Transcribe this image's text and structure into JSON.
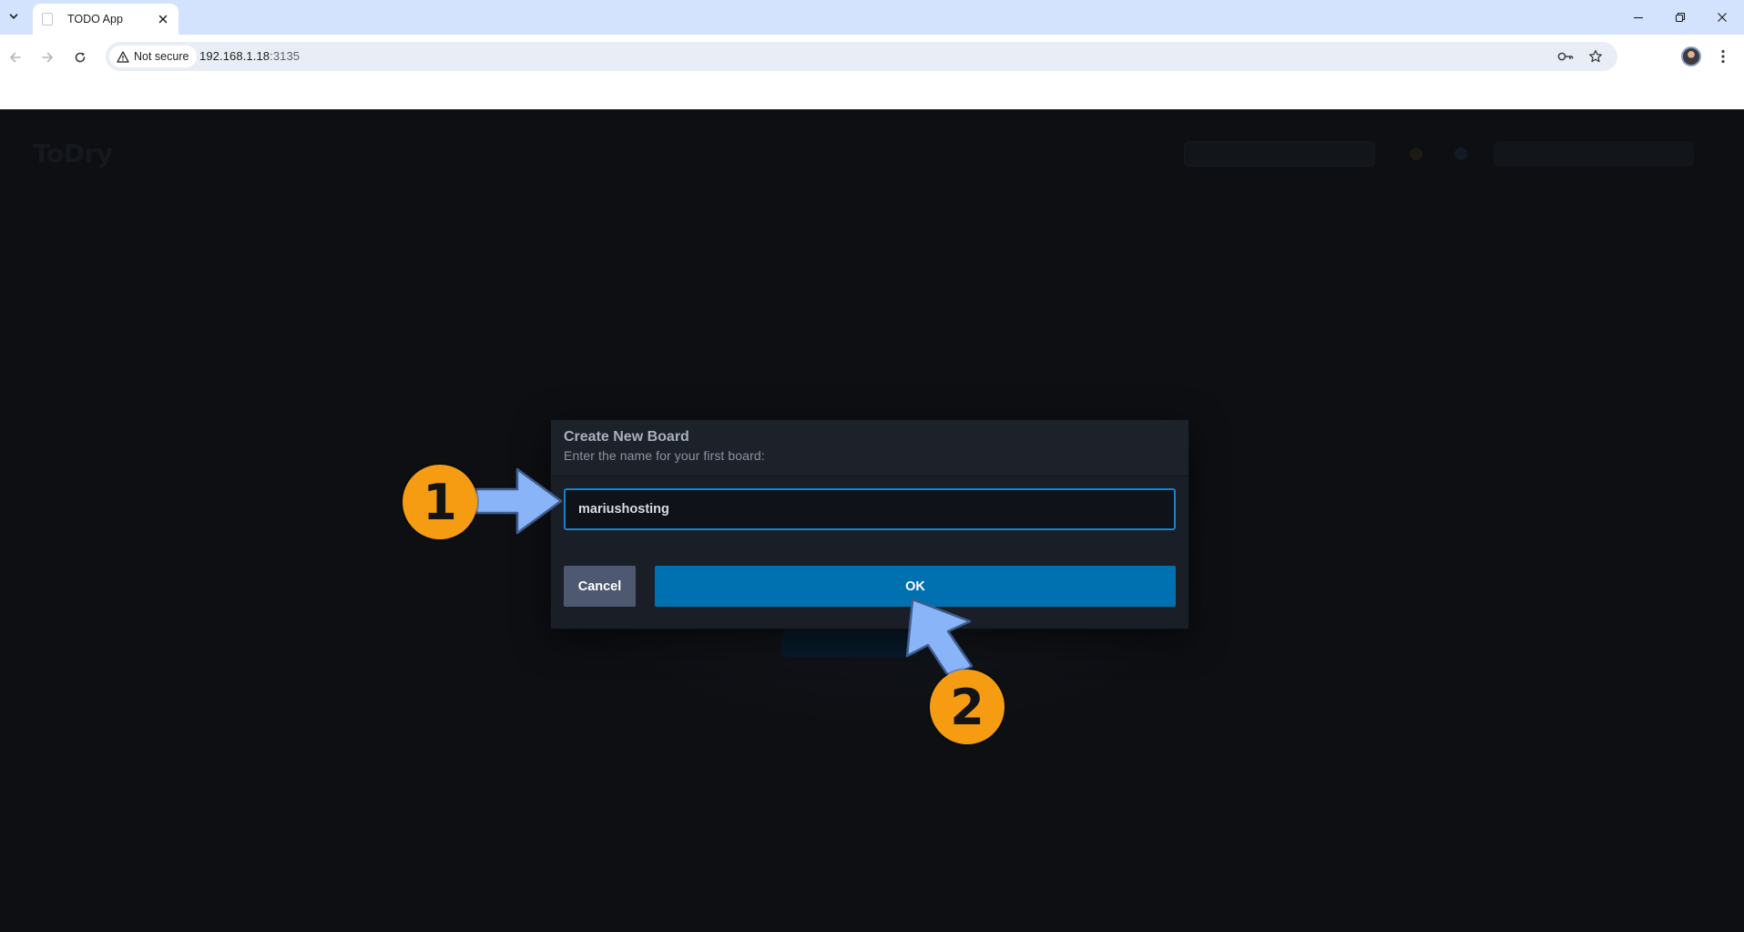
{
  "browser": {
    "tab_title": "TODO App",
    "security_label": "Not secure",
    "url_host": "192.168.1.18",
    "url_port": ":3135"
  },
  "app": {
    "logo": "ToDry"
  },
  "modal": {
    "title": "Create New Board",
    "subtitle": "Enter the name for your first board:",
    "input_value": "mariushosting",
    "cancel_label": "Cancel",
    "ok_label": "OK"
  },
  "annotations": {
    "step_1": "1",
    "step_2": "2"
  },
  "colors": {
    "accent": "#0071b0",
    "input_border": "#1783c9",
    "badge": "#f59c12",
    "arrow": "#8ab4f8"
  }
}
